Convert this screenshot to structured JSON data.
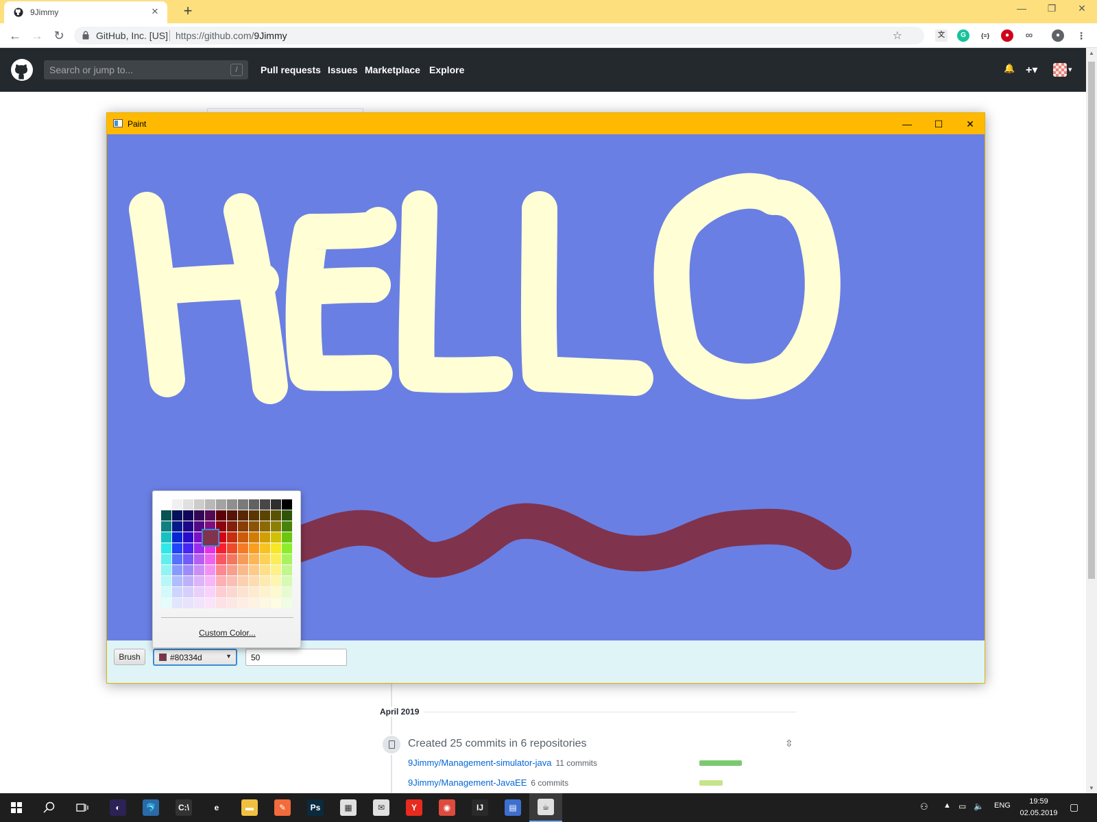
{
  "browser": {
    "tab_title": "9Jimmy",
    "tab_close": "✕",
    "new_tab": "+",
    "window_controls": [
      "—",
      "❐",
      "✕"
    ],
    "nav": {
      "back": "←",
      "forward": "→",
      "reload": "↻"
    },
    "site_identity": "GitHub, Inc. [US]",
    "url_host": "https://github.com/",
    "url_path": "9Jimmy",
    "star": "☆"
  },
  "github": {
    "search_placeholder": "Search or jump to...",
    "search_shortcut": "/",
    "nav": [
      "Pull requests",
      "Issues",
      "Marketplace",
      "Explore"
    ],
    "bell": "🔔",
    "plus": "+▾",
    "avatar_caret": "▾",
    "activity": {
      "month": "April 2019",
      "title": "Created 25 commits in 6 repositories",
      "fold_icon": "⇳",
      "repos": [
        {
          "name": "9Jimmy/Management-simulator-java",
          "commits": "11 commits",
          "bar_fraction": 1.0,
          "color": "#7bc96f"
        },
        {
          "name": "9Jimmy/Management-JavaEE",
          "commits": "6 commits",
          "bar_fraction": 0.55,
          "color": "#c6e48b"
        }
      ]
    }
  },
  "paint": {
    "title": "Paint",
    "controls": [
      "—",
      "☐",
      "✕"
    ],
    "canvas_background": "#6a7fe3",
    "stroke_light": "#fffed4",
    "stroke_selected": "#80334d",
    "tool_button": "Brush",
    "selected_color": "#80334d",
    "brush_size": "50",
    "picker": {
      "custom_label": "Custom Color..."
    }
  },
  "taskbar": {
    "apps": [
      {
        "name": "eclipse",
        "label": "◐",
        "color": "#2c2255"
      },
      {
        "name": "mysql-workbench",
        "label": "🐬",
        "color": "#2a6aa8"
      },
      {
        "name": "terminal",
        "label": "C:\\",
        "color": "#333333"
      },
      {
        "name": "edge",
        "label": "e",
        "color": "#1e1e1e"
      },
      {
        "name": "file-explorer",
        "label": "▬",
        "color": "#f0c040"
      },
      {
        "name": "postman",
        "label": "✎",
        "color": "#f26b3a"
      },
      {
        "name": "photoshop",
        "label": "Ps",
        "color": "#0a2a3e"
      },
      {
        "name": "store",
        "label": "▦",
        "color": "#e0e0e0"
      },
      {
        "name": "mail",
        "label": "✉",
        "color": "#e0e0e0"
      },
      {
        "name": "yandex",
        "label": "Y",
        "color": "#e82b1e"
      },
      {
        "name": "chrome",
        "label": "◉",
        "color": "#dd4b3e"
      },
      {
        "name": "intellij",
        "label": "IJ",
        "color": "#2a2a2a"
      },
      {
        "name": "scene-builder",
        "label": "▤",
        "color": "#3d6fcf"
      },
      {
        "name": "java",
        "label": "☕",
        "color": "#e0e0e0"
      }
    ],
    "tray_lang": "ENG",
    "time": "19:59",
    "date": "02.05.2019"
  }
}
